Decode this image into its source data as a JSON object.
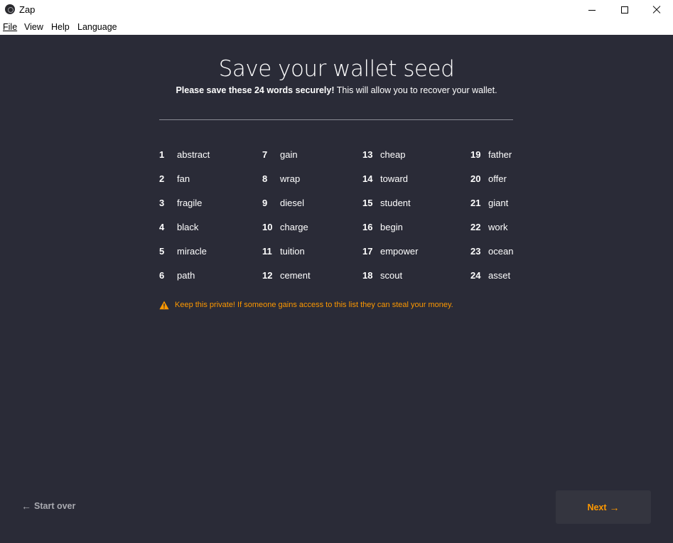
{
  "window": {
    "title": "Zap"
  },
  "menu": {
    "file": "File",
    "view": "View",
    "help": "Help",
    "language": "Language"
  },
  "page": {
    "title": "Save your wallet seed",
    "subtitle_strong": "Please save these 24 words securely!",
    "subtitle_rest": " This will allow you to recover your wallet.",
    "warning": "Keep this private! If someone gains access to this list they can steal your money.",
    "start_over": "Start over",
    "next": "Next"
  },
  "seed": [
    {
      "n": "1",
      "w": "abstract"
    },
    {
      "n": "2",
      "w": "fan"
    },
    {
      "n": "3",
      "w": "fragile"
    },
    {
      "n": "4",
      "w": "black"
    },
    {
      "n": "5",
      "w": "miracle"
    },
    {
      "n": "6",
      "w": "path"
    },
    {
      "n": "7",
      "w": "gain"
    },
    {
      "n": "8",
      "w": "wrap"
    },
    {
      "n": "9",
      "w": "diesel"
    },
    {
      "n": "10",
      "w": "charge"
    },
    {
      "n": "11",
      "w": "tuition"
    },
    {
      "n": "12",
      "w": "cement"
    },
    {
      "n": "13",
      "w": "cheap"
    },
    {
      "n": "14",
      "w": "toward"
    },
    {
      "n": "15",
      "w": "student"
    },
    {
      "n": "16",
      "w": "begin"
    },
    {
      "n": "17",
      "w": "empower"
    },
    {
      "n": "18",
      "w": "scout"
    },
    {
      "n": "19",
      "w": "father"
    },
    {
      "n": "20",
      "w": "offer"
    },
    {
      "n": "21",
      "w": "giant"
    },
    {
      "n": "22",
      "w": "work"
    },
    {
      "n": "23",
      "w": "ocean"
    },
    {
      "n": "24",
      "w": "asset"
    }
  ],
  "colors": {
    "background": "#2a2b37",
    "accent": "#fd9800",
    "button_bg": "#34353f"
  },
  "icons": {
    "app": "zap-logo-icon",
    "warning": "warning-triangle-icon",
    "back": "arrow-left-icon",
    "forward": "arrow-right-icon"
  }
}
